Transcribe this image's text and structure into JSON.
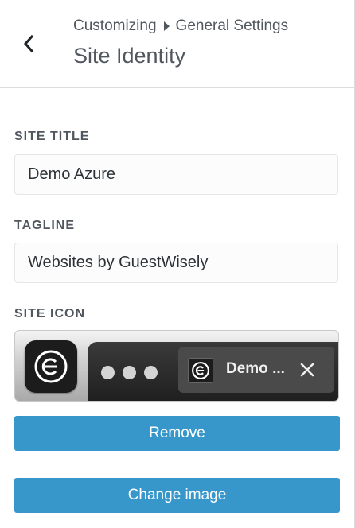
{
  "header": {
    "back_icon": "chevron-left-icon",
    "breadcrumb": {
      "parent": "Customizing",
      "child": "General Settings",
      "separator_icon": "caret-right-icon"
    },
    "title": "Site Identity"
  },
  "fields": {
    "site_title": {
      "label": "SITE TITLE",
      "value": "Demo Azure"
    },
    "tagline": {
      "label": "TAGLINE",
      "value": "Websites by GuestWisely"
    }
  },
  "site_icon": {
    "label": "SITE ICON",
    "preview_tab_title": "Demo ...",
    "logo_icon": "guestwisely-logo-icon",
    "close_icon": "close-icon"
  },
  "buttons": {
    "remove": "Remove",
    "change_image": "Change image"
  },
  "colors": {
    "accent": "#3797cb",
    "text_muted": "#50575e",
    "border": "#dcdcde"
  }
}
